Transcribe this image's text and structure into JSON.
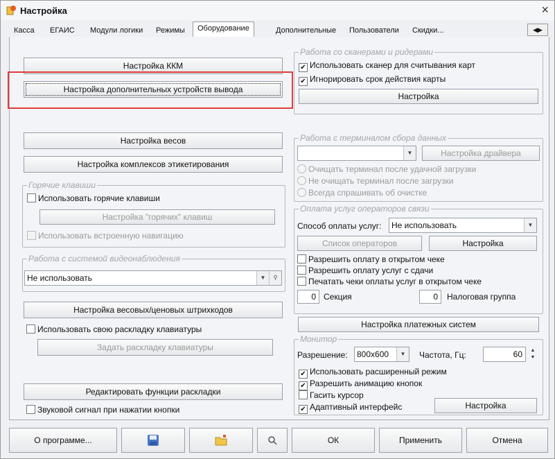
{
  "window": {
    "title": "Настройка",
    "close_glyph": "×"
  },
  "tabs": [
    {
      "label": "Касса"
    },
    {
      "label": "ЕГАИС"
    },
    {
      "label": "Модули логики"
    },
    {
      "label": "Режимы"
    },
    {
      "label": "Оборудование"
    },
    {
      "label": "Дополнительные"
    },
    {
      "label": "Пользователи"
    },
    {
      "label": "Скидки..."
    }
  ],
  "active_tab": "Оборудование",
  "left": {
    "kkm_button": "Настройка ККМ",
    "output_devices_button": "Настройка дополнительных устройств вывода",
    "scales_button": "Настройка весов",
    "labeling_button": "Настройка комплексов этикетирования",
    "hotkeys": {
      "legend": "Горячие клавиши",
      "use_hotkeys": "Использовать горячие клавиши",
      "hotkeys_setup_button": "Настройка \"горячих\" клавиш",
      "builtin_nav": "Использовать встроенную навигацию"
    },
    "video": {
      "legend": "Работа с системой видеонаблюдения",
      "value": "Не использовать"
    },
    "barcodes_button": "Настройка весовых/ценовых штрихкодов",
    "own_layout": "Использовать свою раскладку клавиатуры",
    "set_layout_button": "Задать раскладку клавиатуры",
    "edit_layout_functions_button": "Редактировать функции раскладки",
    "beep_on_press": "Звуковой сигнал при нажатии кнопки"
  },
  "right": {
    "scanners": {
      "legend": "Работа со сканерами и ридерами",
      "use_scanner": "Использовать сканер для считывания карт",
      "ignore_expiry": "Игнорировать срок действия карты",
      "setup_button": "Настройка"
    },
    "terminal": {
      "legend": "Работа с терминалом сбора данных",
      "driver_button": "Настройка драйвера",
      "clear_after_upload": "Очищать терминал после удачной загрузки",
      "no_clear": "Не очищать терминал после загрузки",
      "always_ask": "Всегда спрашивать об очистке"
    },
    "payments": {
      "legend": "Оплата услуг операторов связи",
      "method_label": "Способ оплаты услуг:",
      "method_value": "Не использовать",
      "operators_button": "Список операторов",
      "setup_button": "Настройка",
      "allow_open_check": "Разрешить оплату в открытом чеке",
      "allow_from_change": "Разрешить оплату услуг с сдачи",
      "print_in_open_check": "Печатать чеки оплаты услуг в открытом чеке",
      "section_value": "0",
      "section_label": "Секция",
      "tax_group_value": "0",
      "tax_group_label": "Налоговая группа",
      "payment_systems_button": "Настройка платежных систем"
    },
    "monitor": {
      "legend": "Монитор",
      "resolution_label": "Разрешение:",
      "resolution_value": "800х600",
      "frequency_label": "Частота, Гц:",
      "frequency_value": "60",
      "extended_mode": "Использовать расширенный режим",
      "button_animation": "Разрешить анимацию кнопок",
      "hide_cursor": "Гасить курсор",
      "adaptive_ui": "Адаптивный интерфейс",
      "setup_button": "Настройка"
    }
  },
  "footer": {
    "about_button": "О программе...",
    "ok_button": "ОК",
    "apply_button": "Применить",
    "cancel_button": "Отмена"
  },
  "checks": {
    "use_scanner": true,
    "ignore_expiry": true,
    "use_hotkeys": false,
    "builtin_nav": false,
    "own_layout": false,
    "beep_on_press": false,
    "allow_open_check": false,
    "allow_from_change": false,
    "print_in_open_check": false,
    "extended_mode": true,
    "button_animation": true,
    "hide_cursor": false,
    "adaptive_ui": true
  },
  "colors": {
    "highlight": "#e23b3b",
    "legend": "#a0a6ae"
  }
}
